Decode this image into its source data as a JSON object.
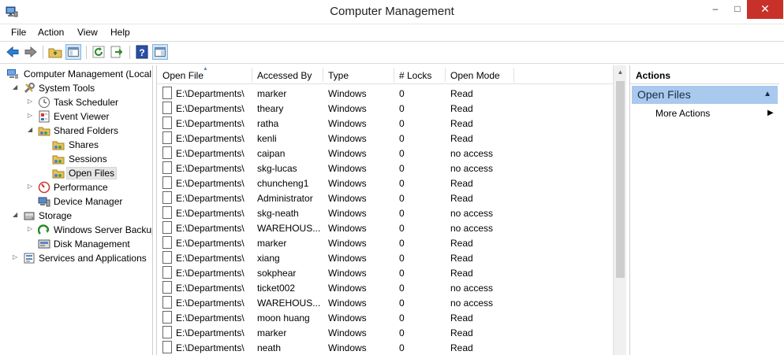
{
  "window": {
    "title": "Computer Management",
    "minimize": "–",
    "maximize": "□",
    "close": "✕"
  },
  "menu": [
    "File",
    "Action",
    "View",
    "Help"
  ],
  "toolbar": {
    "icons": [
      "back-icon",
      "forward-icon",
      "up-folder-icon",
      "show-hide-console-tree-icon",
      "refresh-icon",
      "export-list-icon",
      "help-icon",
      "show-hide-action-pane-icon"
    ]
  },
  "tree": {
    "items": [
      {
        "label": "Computer Management (Local",
        "icon": "computer-management-icon",
        "expander": "",
        "level": 0
      },
      {
        "label": "System Tools",
        "icon": "system-tools-icon",
        "expander": "◢",
        "level": 1
      },
      {
        "label": "Task Scheduler",
        "icon": "clock-icon",
        "expander": "▷",
        "level": 2
      },
      {
        "label": "Event Viewer",
        "icon": "event-viewer-icon",
        "expander": "▷",
        "level": 2
      },
      {
        "label": "Shared Folders",
        "icon": "shared-folder-icon",
        "expander": "◢",
        "level": 2
      },
      {
        "label": "Shares",
        "icon": "shared-folder-icon",
        "expander": "",
        "level": 3
      },
      {
        "label": "Sessions",
        "icon": "shared-folder-icon",
        "expander": "",
        "level": 3
      },
      {
        "label": "Open Files",
        "icon": "shared-folder-icon",
        "expander": "",
        "level": 3,
        "selected": true
      },
      {
        "label": "Performance",
        "icon": "performance-icon",
        "expander": "▷",
        "level": 2
      },
      {
        "label": "Device Manager",
        "icon": "device-manager-icon",
        "expander": "",
        "level": 2
      },
      {
        "label": "Storage",
        "icon": "storage-icon",
        "expander": "◢",
        "level": 1
      },
      {
        "label": "Windows Server Backup",
        "icon": "backup-icon",
        "expander": "▷",
        "level": 2
      },
      {
        "label": "Disk Management",
        "icon": "disk-management-icon",
        "expander": "",
        "level": 2
      },
      {
        "label": "Services and Applications",
        "icon": "services-icon",
        "expander": "▷",
        "level": 1
      }
    ]
  },
  "list": {
    "columns": [
      "Open File",
      "Accessed By",
      "Type",
      "# Locks",
      "Open Mode"
    ],
    "rows": [
      [
        "E:\\Departments\\",
        "marker",
        "Windows",
        "0",
        "Read"
      ],
      [
        "E:\\Departments\\",
        "theary",
        "Windows",
        "0",
        "Read"
      ],
      [
        "E:\\Departments\\",
        "ratha",
        "Windows",
        "0",
        "Read"
      ],
      [
        "E:\\Departments\\",
        "kenli",
        "Windows",
        "0",
        "Read"
      ],
      [
        "E:\\Departments\\",
        "caipan",
        "Windows",
        "0",
        "no access"
      ],
      [
        "E:\\Departments\\",
        "skg-lucas",
        "Windows",
        "0",
        "no access"
      ],
      [
        "E:\\Departments\\",
        "chuncheng1",
        "Windows",
        "0",
        "Read"
      ],
      [
        "E:\\Departments\\",
        "Administrator",
        "Windows",
        "0",
        "Read"
      ],
      [
        "E:\\Departments\\",
        "skg-neath",
        "Windows",
        "0",
        "no access"
      ],
      [
        "E:\\Departments\\",
        "WAREHOUS...",
        "Windows",
        "0",
        "no access"
      ],
      [
        "E:\\Departments\\",
        "marker",
        "Windows",
        "0",
        "Read"
      ],
      [
        "E:\\Departments\\",
        "xiang",
        "Windows",
        "0",
        "Read"
      ],
      [
        "E:\\Departments\\",
        "sokphear",
        "Windows",
        "0",
        "Read"
      ],
      [
        "E:\\Departments\\",
        "ticket002",
        "Windows",
        "0",
        "no access"
      ],
      [
        "E:\\Departments\\",
        "WAREHOUS...",
        "Windows",
        "0",
        "no access"
      ],
      [
        "E:\\Departments\\",
        "moon huang",
        "Windows",
        "0",
        "Read"
      ],
      [
        "E:\\Departments\\",
        "marker",
        "Windows",
        "0",
        "Read"
      ],
      [
        "E:\\Departments\\",
        "neath",
        "Windows",
        "0",
        "Read"
      ]
    ]
  },
  "actions": {
    "header": "Actions",
    "section": "Open Files",
    "collapse_glyph": "▲",
    "more": "More Actions",
    "more_arrow": "▶"
  },
  "colors": {
    "accent": "#a9c9ee",
    "close": "#c7312a"
  }
}
